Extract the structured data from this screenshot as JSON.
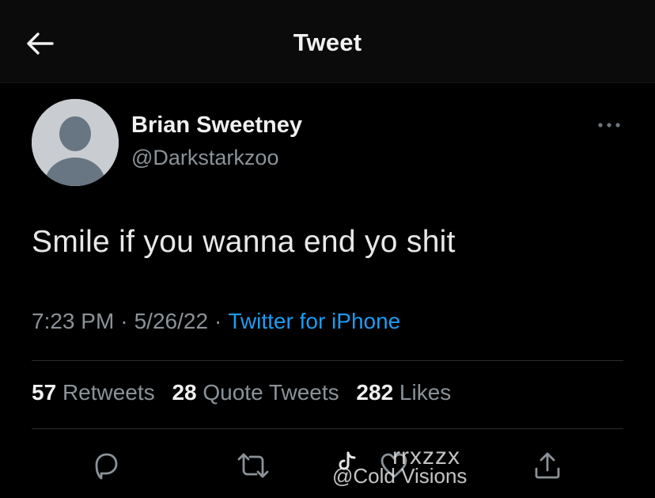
{
  "header": {
    "title": "Tweet",
    "back_icon": "arrow-left-icon"
  },
  "author": {
    "display_name": "Brian Sweetney",
    "handle": "@Darkstarkzoo",
    "avatar_icon": "default-avatar-icon",
    "more_icon": "more-horizontal-icon"
  },
  "tweet": {
    "text": "Smile if you wanna end yo shit"
  },
  "meta": {
    "time": "7:23 PM",
    "separator": "·",
    "date": "5/26/22",
    "source": "Twitter for iPhone"
  },
  "stats": {
    "retweets_count": "57",
    "retweets_label": "Retweets",
    "quotes_count": "28",
    "quotes_label": "Quote Tweets",
    "likes_count": "282",
    "likes_label": "Likes"
  },
  "actions": [
    {
      "icon": "reply-icon"
    },
    {
      "icon": "retweet-icon"
    },
    {
      "icon": "like-icon"
    },
    {
      "icon": "share-icon"
    }
  ],
  "watermark": {
    "top": "rrxzzx",
    "bottom": "@Cold Visions",
    "logo_icon": "tiktok-logo-icon"
  },
  "colors": {
    "background": "#000000",
    "header_bg": "#0b0b0b",
    "accent": "#1d9bf0",
    "secondary_text": "#8b9298"
  }
}
